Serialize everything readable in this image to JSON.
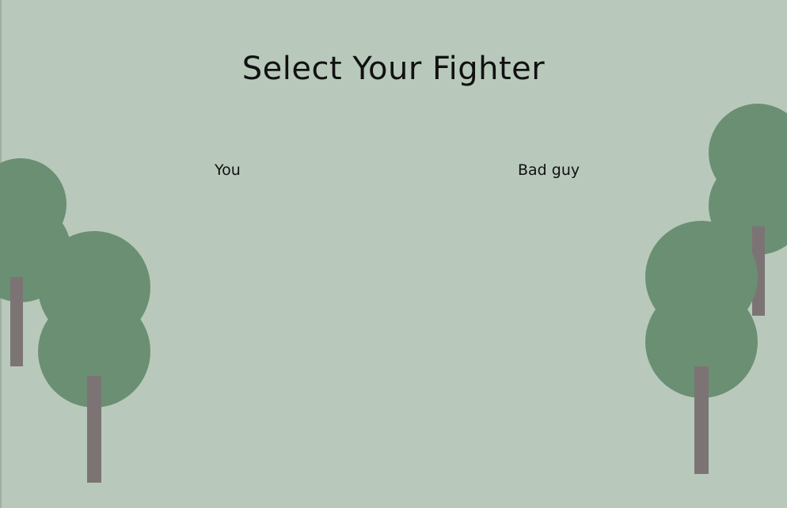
{
  "screen": {
    "title": "Select Your Fighter"
  },
  "fighters": {
    "player_label": "You",
    "opponent_label": "Bad guy"
  },
  "colors": {
    "background": "#b8c9bb",
    "tree_foliage": "#6b8f73",
    "tree_trunk": "#7c7474",
    "text": "#111111"
  }
}
